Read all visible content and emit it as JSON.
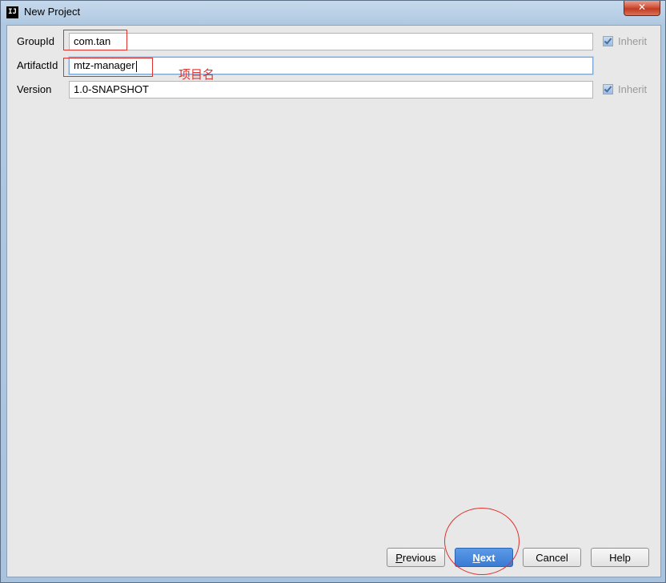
{
  "window": {
    "title": "New Project",
    "app_icon_text": "IJ",
    "close_glyph": "✕"
  },
  "form": {
    "group_id": {
      "label": "GroupId",
      "value": "com.tan",
      "inherit_label": "Inherit",
      "inherit_checked": true
    },
    "artifact_id": {
      "label": "ArtifactId",
      "value": "mtz-manager"
    },
    "version": {
      "label": "Version",
      "value": "1.0-SNAPSHOT",
      "inherit_label": "Inherit",
      "inherit_checked": true
    }
  },
  "annotation": {
    "text": "项目名",
    "color": "#e0312b"
  },
  "buttons": {
    "previous": {
      "mnemonic": "P",
      "rest": "revious"
    },
    "next": {
      "mnemonic": "N",
      "rest": "ext"
    },
    "cancel": "Cancel",
    "help": "Help"
  },
  "colors": {
    "accent": "#3a7bd5",
    "annotation_red": "#e0312b",
    "panel_bg": "#e8e8e8"
  }
}
